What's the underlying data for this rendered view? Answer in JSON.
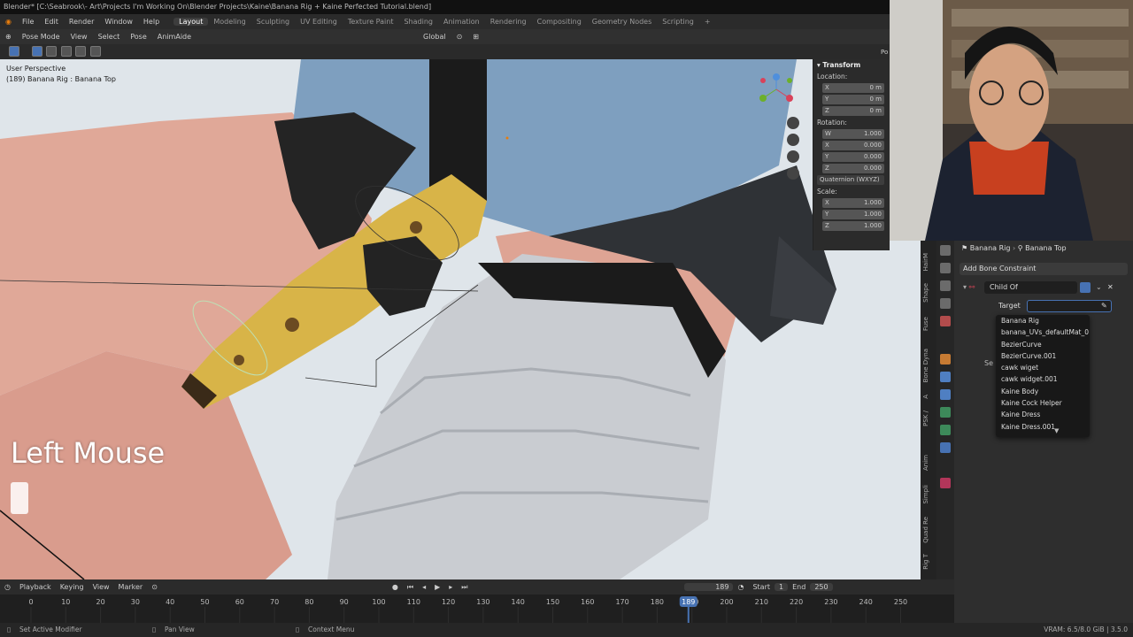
{
  "titlebar": {
    "text": "Blender* [C:\\Seabrook\\- Art\\Projects I'm Working On\\Blender Projects\\Kaine\\Banana Rig + Kaine Perfected Tutorial.blend]"
  },
  "menu": {
    "items": [
      "File",
      "Edit",
      "Render",
      "Window",
      "Help"
    ]
  },
  "workspaces": {
    "items": [
      "Layout",
      "Modeling",
      "Sculpting",
      "UV Editing",
      "Texture Paint",
      "Shading",
      "Animation",
      "Rendering",
      "Compositing",
      "Geometry Nodes",
      "Scripting",
      "+"
    ],
    "active": "Layout"
  },
  "header": {
    "mode": "Pose Mode",
    "view": "View",
    "select": "Select",
    "pose": "Pose",
    "animaide": "AnimAide",
    "orientation": "Global"
  },
  "viewport": {
    "perspective": "User Perspective",
    "object_info": "(189) Banana Rig : Banana Top",
    "overlay_text": "Left Mouse"
  },
  "npanel": {
    "title": "Transform",
    "location_label": "Location:",
    "location": [
      {
        "axis": "X",
        "value": "0 m"
      },
      {
        "axis": "Y",
        "value": "0 m"
      },
      {
        "axis": "Z",
        "value": "0 m"
      }
    ],
    "rotation_label": "Rotation:",
    "rotation": [
      {
        "axis": "W",
        "value": "1.000"
      },
      {
        "axis": "X",
        "value": "0.000"
      },
      {
        "axis": "Y",
        "value": "0.000"
      },
      {
        "axis": "Z",
        "value": "0.000"
      }
    ],
    "rotation_mode": "Quaternion (WXYZ)",
    "scale_label": "Scale:",
    "scale": [
      {
        "axis": "X",
        "value": "1.000"
      },
      {
        "axis": "Y",
        "value": "1.000"
      },
      {
        "axis": "Z",
        "value": "1.000"
      }
    ],
    "extra_label": "Po"
  },
  "sidetabs": [
    "HairM",
    "Shape",
    "Fuse",
    "Bone Dyna",
    "A",
    "PSK /",
    "Anim",
    "Simpli",
    "Quad Re",
    "Rig T"
  ],
  "properties": {
    "breadcrumb_object": "Banana Rig",
    "breadcrumb_bone": "Banana Top",
    "add_constraint": "Add Bone Constraint",
    "constraint_name": "Child Of",
    "target_label": "Target",
    "partial_label": "Se"
  },
  "dropdown": {
    "items": [
      "Banana Rig",
      "banana_UVs_defaultMat_0",
      "BezierCurve",
      "BezierCurve.001",
      "cawk wiget",
      "cawk widget.001",
      "Kaine Body",
      "Kaine Cock Helper",
      "Kaine Dress",
      "Kaine Dress.001"
    ]
  },
  "timeline": {
    "playback": "Playback",
    "keying": "Keying",
    "view": "View",
    "marker": "Marker",
    "current_frame": "189",
    "start_label": "Start",
    "start": "1",
    "end_label": "End",
    "end": "250",
    "ticks": [
      "0",
      "10",
      "20",
      "30",
      "40",
      "50",
      "60",
      "70",
      "80",
      "90",
      "100",
      "110",
      "120",
      "130",
      "140",
      "150",
      "160",
      "170",
      "180",
      "190",
      "200",
      "210",
      "220",
      "230",
      "240",
      "250"
    ],
    "playhead": "189"
  },
  "statusbar": {
    "left": "Set Active Modifier",
    "middle": "Pan View",
    "right": "Context Menu",
    "version": "VRAM: 6.5/8.0 GiB | 3.5.0"
  },
  "colors": {
    "accent": "#4772b3",
    "viewport_bg": "#dfe5ea"
  }
}
